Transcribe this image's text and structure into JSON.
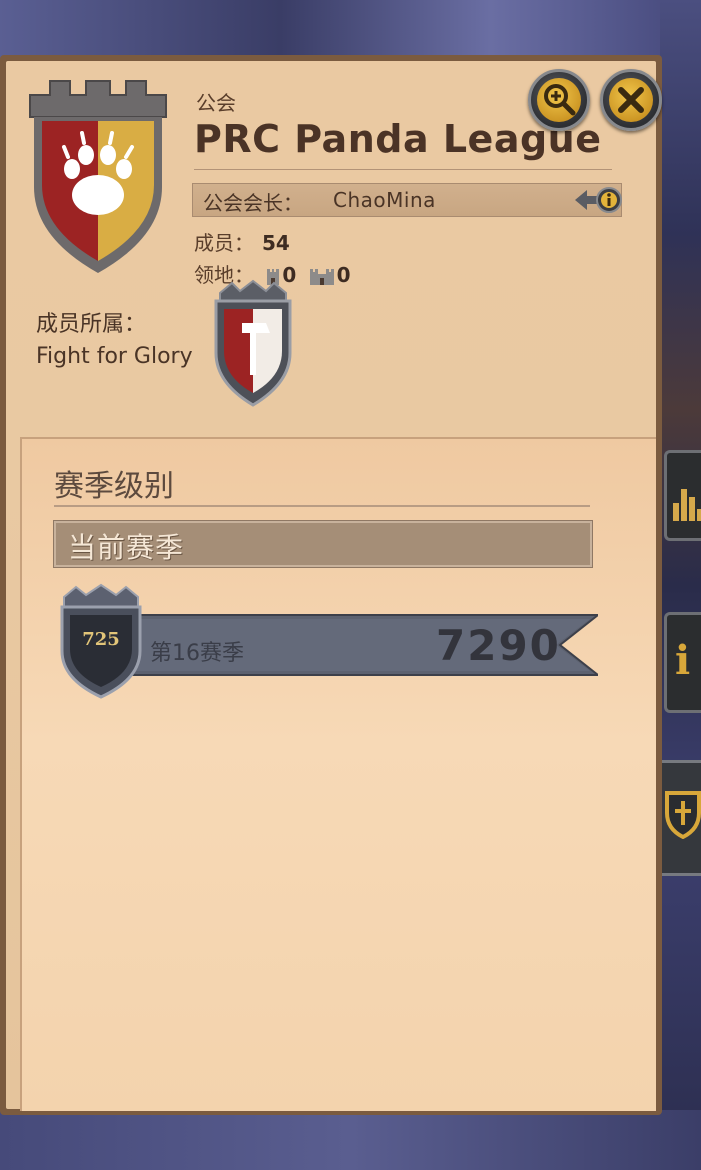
{
  "guild": {
    "kicker": "公会",
    "name": "PRC Panda League",
    "leader_label": "公会会长：",
    "leader_name": "ChaoMina",
    "members_label": "成员：",
    "members_value": "54",
    "territory_label": "领地：",
    "territory_castles": "0",
    "territory_strongholds": "0",
    "alliance_label_line1": "成员所属：",
    "alliance_name": "Fight for Glory"
  },
  "season": {
    "title": "赛季级别",
    "current_tab": "当前赛季",
    "rank_number": "725",
    "season_name": "第16赛季",
    "score": "7290"
  },
  "icons": {
    "zoom": "zoom-in-icon",
    "close": "close-icon",
    "info": "info-icon"
  },
  "colors": {
    "panel_bg": "#eac9a2",
    "panel_border": "#7b5b3f",
    "title_text": "#4b3326",
    "gold": "#e2b33a",
    "ribbon": "#5d6270"
  }
}
